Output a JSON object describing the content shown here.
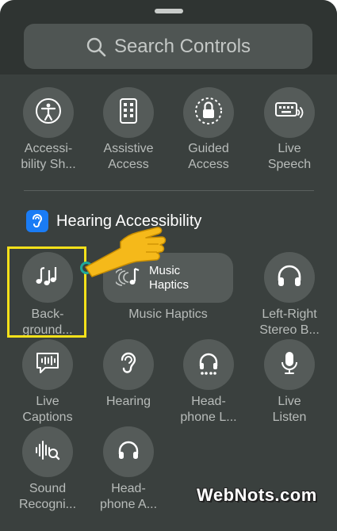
{
  "search": {
    "placeholder": "Search Controls"
  },
  "row1": [
    {
      "label": "Accessi-\nbility Sh...",
      "icon": "accessibility-icon"
    },
    {
      "label": "Assistive\nAccess",
      "icon": "assistive-access-icon"
    },
    {
      "label": "Guided\nAccess",
      "icon": "guided-access-lock-icon"
    },
    {
      "label": "Live\nSpeech",
      "icon": "keyboard-speech-icon"
    }
  ],
  "section": {
    "title": "Hearing Accessibility",
    "icon": "ear-icon",
    "color": "#1a7cf5"
  },
  "row2": {
    "background": {
      "label": "Back-\nground...",
      "icon": "music-notes-icon"
    },
    "music_haptics": {
      "title": "Music\nHaptics",
      "label": "Music Haptics",
      "icon": "music-haptics-icon"
    },
    "left_right": {
      "label": "Left-Right\nStereo B...",
      "icon": "headphones-icon"
    }
  },
  "row3": [
    {
      "label": "Live\nCaptions",
      "icon": "live-captions-icon"
    },
    {
      "label": "Hearing",
      "icon": "ear-icon"
    },
    {
      "label": "Head-\nphone L...",
      "icon": "headphone-level-icon"
    },
    {
      "label": "Live\nListen",
      "icon": "microphone-icon"
    }
  ],
  "row4": [
    {
      "label": "Sound\nRecogni...",
      "icon": "sound-recognition-icon"
    },
    {
      "label": "Head-\nphone A...",
      "icon": "headphones-icon"
    }
  ],
  "watermark": "WebNots.com",
  "colors": {
    "highlight": "#f5e11a",
    "pointer": "#f5b91a",
    "indicator": "#1fa89a"
  }
}
